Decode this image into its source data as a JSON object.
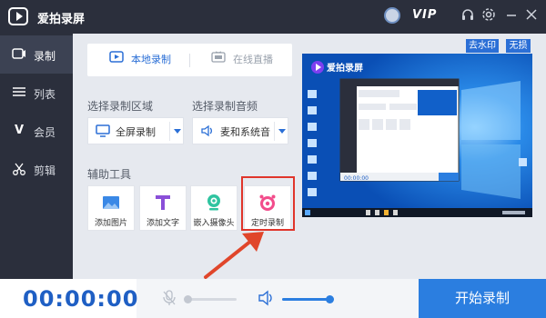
{
  "app": {
    "title": "爱拍录屏",
    "vip_label": "VIP"
  },
  "sidebar": {
    "items": [
      {
        "label": "录制",
        "icon": "record-icon",
        "active": true
      },
      {
        "label": "列表",
        "icon": "list-icon",
        "active": false
      },
      {
        "label": "会员",
        "icon": "vip-v-icon",
        "active": false
      },
      {
        "label": "剪辑",
        "icon": "scissors-icon",
        "active": false
      }
    ]
  },
  "tabs": [
    {
      "label": "本地录制",
      "icon": "play-icon",
      "active": true
    },
    {
      "label": "在线直播",
      "icon": "live-icon",
      "active": false
    }
  ],
  "record_area": {
    "label": "选择录制区域",
    "selected": "全屏录制"
  },
  "record_audio": {
    "label": "选择录制音频",
    "selected": "麦和系统音"
  },
  "assist_tools": {
    "label": "辅助工具",
    "items": [
      {
        "label": "添加图片",
        "icon": "image-icon"
      },
      {
        "label": "添加文字",
        "icon": "text-t-icon"
      },
      {
        "label": "嵌入摄像头",
        "icon": "webcam-icon"
      },
      {
        "label": "定时录制",
        "icon": "alarm-clock-icon"
      }
    ]
  },
  "preview": {
    "tags": [
      "去水印",
      "无损"
    ],
    "watermark": "爱拍录屏",
    "inner_timer": "00:00:00"
  },
  "bottom": {
    "timer": "00:00:00",
    "start_label": "开始录制",
    "mic_muted": true,
    "mic_level": 0.0,
    "speaker_level": 1.0
  },
  "colors": {
    "accent": "#2b7ee0",
    "highlight": "#e0352b",
    "sidebar": "#2b2f3c"
  }
}
